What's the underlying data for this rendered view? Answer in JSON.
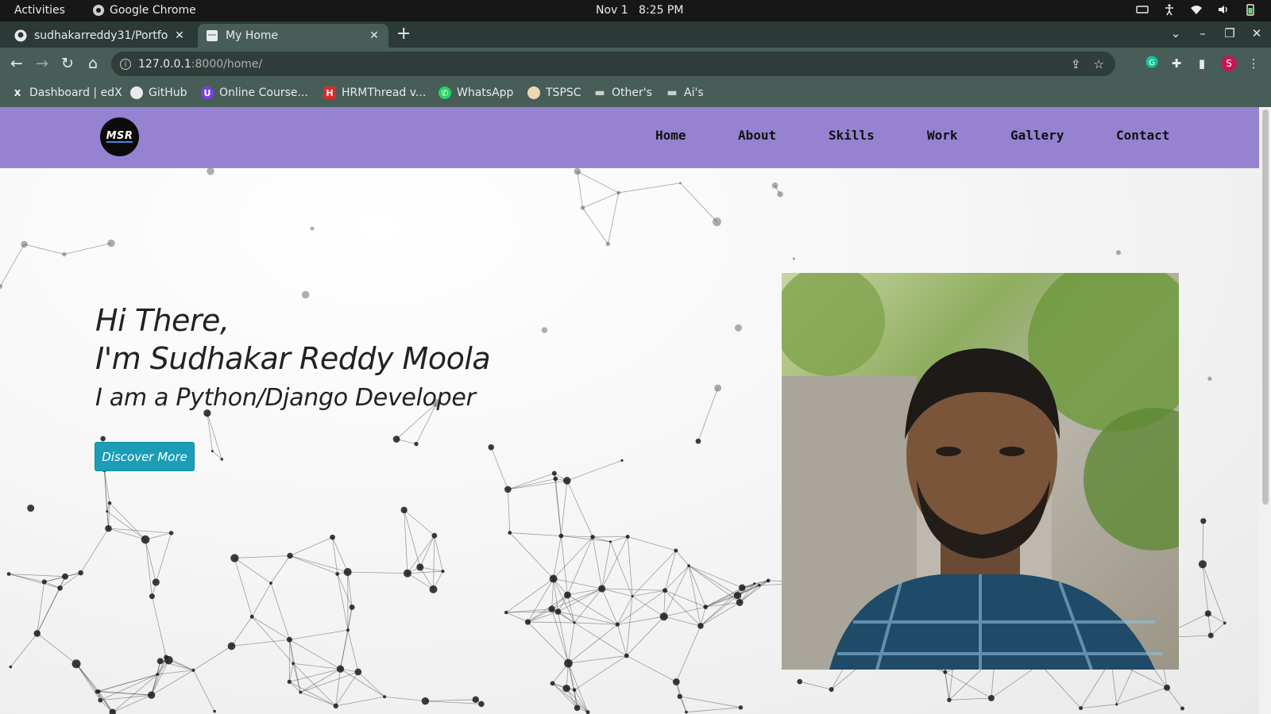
{
  "os": {
    "activities": "Activities",
    "app_name": "Google Chrome",
    "date": "Nov 1",
    "time": "8:25 PM"
  },
  "browser": {
    "tabs": [
      {
        "title": "sudhakarreddy31/Portfo",
        "active": false
      },
      {
        "title": "My Home",
        "active": true
      }
    ],
    "url_host": "127.0.0.1",
    "url_path": ":8000/home/",
    "profile_initial": "S",
    "bookmarks": [
      {
        "label": "Dashboard | edX",
        "icon": "edx-icon"
      },
      {
        "label": "GitHub",
        "icon": "github-icon"
      },
      {
        "label": "Online Course...",
        "icon": "online-course-icon"
      },
      {
        "label": "HRMThread v...",
        "icon": "hrmthread-icon"
      },
      {
        "label": "WhatsApp",
        "icon": "whatsapp-icon"
      },
      {
        "label": "TSPSC",
        "icon": "tspsc-icon"
      },
      {
        "label": "Other's",
        "icon": "folder-icon"
      },
      {
        "label": "Ai's",
        "icon": "folder-icon"
      }
    ]
  },
  "site": {
    "logo_text": "MSR",
    "nav": [
      "Home",
      "About",
      "Skills",
      "Work",
      "Gallery",
      "Contact"
    ],
    "greeting": "Hi There,",
    "name_line": "I'm Sudhakar Reddy Moola",
    "role_line": "I am a Python/Django Developer",
    "cta_label": "Discover More",
    "colors": {
      "nav_bg": "#9583d1",
      "cta_bg": "#1b9db7",
      "browser_frame": "#485d58"
    }
  }
}
